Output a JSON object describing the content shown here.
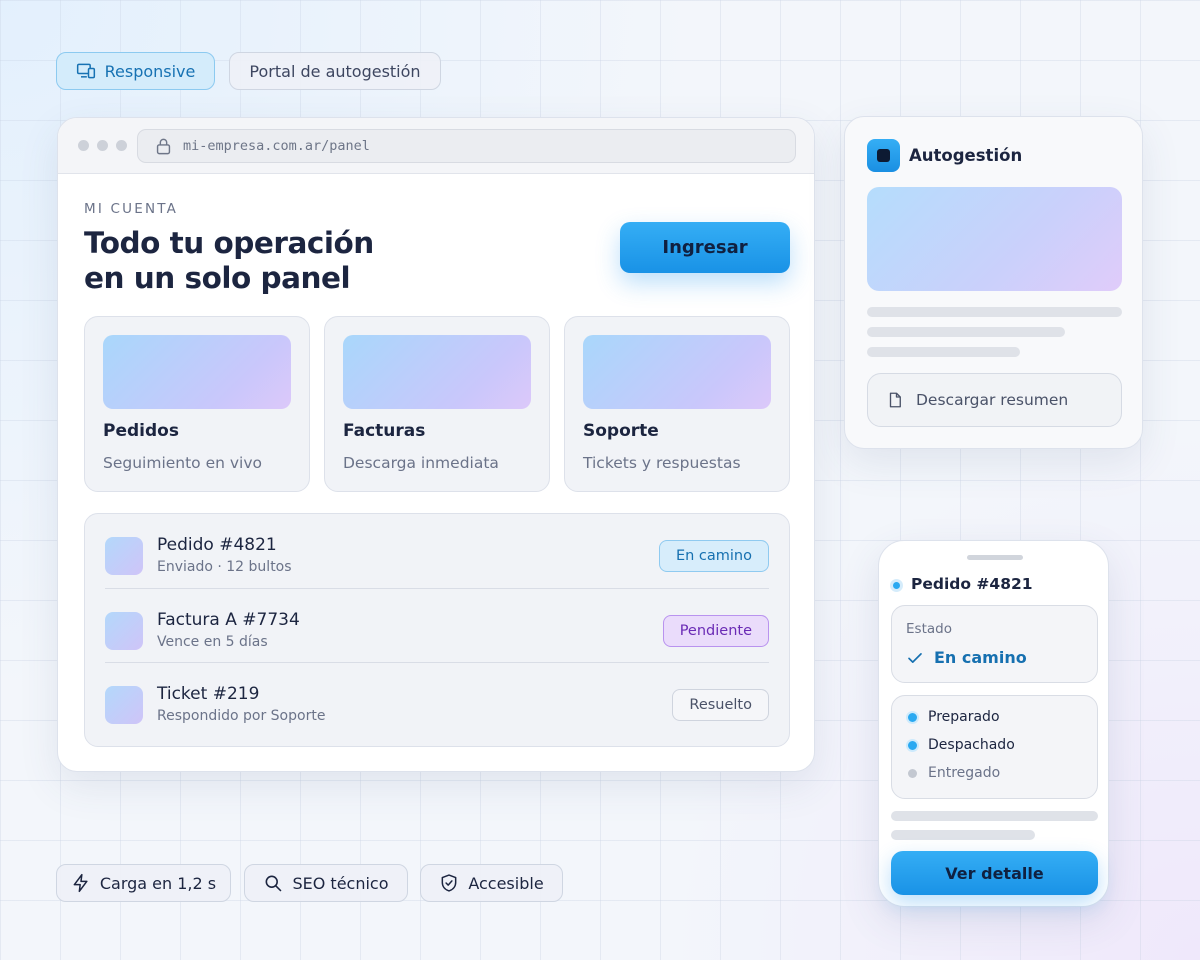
{
  "top_pills": [
    {
      "label": "Responsive",
      "icon": "devices-icon",
      "active": true
    },
    {
      "label": "Portal de autogestión",
      "active": false
    }
  ],
  "browser": {
    "url": "mi-empresa.com.ar/panel",
    "eyebrow": "MI CUENTA",
    "headline_line1": "Todo tu operación",
    "headline_line2": "en un solo panel",
    "login_button": "Ingresar",
    "features": [
      {
        "title": "Pedidos",
        "subtitle": "Seguimiento en vivo"
      },
      {
        "title": "Facturas",
        "subtitle": "Descarga inmediata"
      },
      {
        "title": "Soporte",
        "subtitle": "Tickets y respuestas"
      }
    ],
    "rows": [
      {
        "title": "Pedido #4821",
        "subtitle": "Enviado · 12 bultos",
        "status": "En camino",
        "status_color": "#1670b0"
      },
      {
        "title": "Factura A #7734",
        "subtitle": "Vence en 5 días",
        "status": "Pendiente",
        "status_color": "#6a2bb5"
      },
      {
        "title": "Ticket #219",
        "subtitle": "Respondido por Soporte",
        "status": "Resuelto",
        "status_color": "#4a5268"
      }
    ]
  },
  "self_service": {
    "title": "Autogestión",
    "download_button": "Descargar resumen"
  },
  "phone": {
    "order_title": "Pedido #4821",
    "state_label": "Estado",
    "state_value": "En camino",
    "steps": [
      {
        "label": "Preparado",
        "done": true
      },
      {
        "label": "Despachado",
        "done": true
      },
      {
        "label": "Entregado",
        "done": false
      }
    ],
    "detail_button": "Ver detalle"
  },
  "bottom_pills": [
    {
      "label": "Carga en 1,2 s",
      "icon": "lightning-icon"
    },
    {
      "label": "SEO técnico",
      "icon": "search-icon"
    },
    {
      "label": "Accesible",
      "icon": "shield-check-icon"
    }
  ],
  "colors": {
    "accent": "#1a9bec",
    "ink": "#1c2540",
    "muted": "#6b7389"
  }
}
